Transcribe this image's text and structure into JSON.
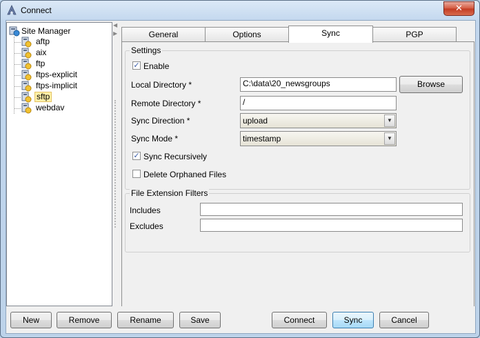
{
  "window": {
    "title": "Connect",
    "close_symbol": "✕"
  },
  "tree": {
    "root": "Site Manager",
    "items": [
      {
        "label": "aftp",
        "selected": false
      },
      {
        "label": "aix",
        "selected": false
      },
      {
        "label": "ftp",
        "selected": false
      },
      {
        "label": "ftps-explicit",
        "selected": false
      },
      {
        "label": "ftps-implicit",
        "selected": false
      },
      {
        "label": "sftp",
        "selected": true
      },
      {
        "label": "webdav",
        "selected": false
      }
    ]
  },
  "tabs": [
    {
      "label": "General",
      "active": false
    },
    {
      "label": "Options",
      "active": false
    },
    {
      "label": "Sync",
      "active": true
    },
    {
      "label": "PGP",
      "active": false
    }
  ],
  "settings": {
    "legend": "Settings",
    "enable": {
      "label": "Enable",
      "checked": true
    },
    "local_directory": {
      "label": "Local Directory *",
      "value": "C:\\data\\20_newsgroups",
      "browse_label": "Browse"
    },
    "remote_directory": {
      "label": "Remote Directory *",
      "value": "/"
    },
    "sync_direction": {
      "label": "Sync Direction *",
      "value": "upload"
    },
    "sync_mode": {
      "label": "Sync Mode *",
      "value": "timestamp"
    },
    "sync_recursively": {
      "label": "Sync Recursively",
      "checked": true
    },
    "delete_orphaned": {
      "label": "Delete Orphaned Files",
      "checked": false
    }
  },
  "filters": {
    "legend": "File Extension Filters",
    "includes": {
      "label": "Includes",
      "value": ""
    },
    "excludes": {
      "label": "Excludes",
      "value": ""
    }
  },
  "buttons": {
    "new": "New",
    "remove": "Remove",
    "rename": "Rename",
    "save": "Save",
    "connect": "Connect",
    "sync": "Sync",
    "cancel": "Cancel"
  },
  "check_mark": "✓",
  "dropdown_arrow": "▼"
}
